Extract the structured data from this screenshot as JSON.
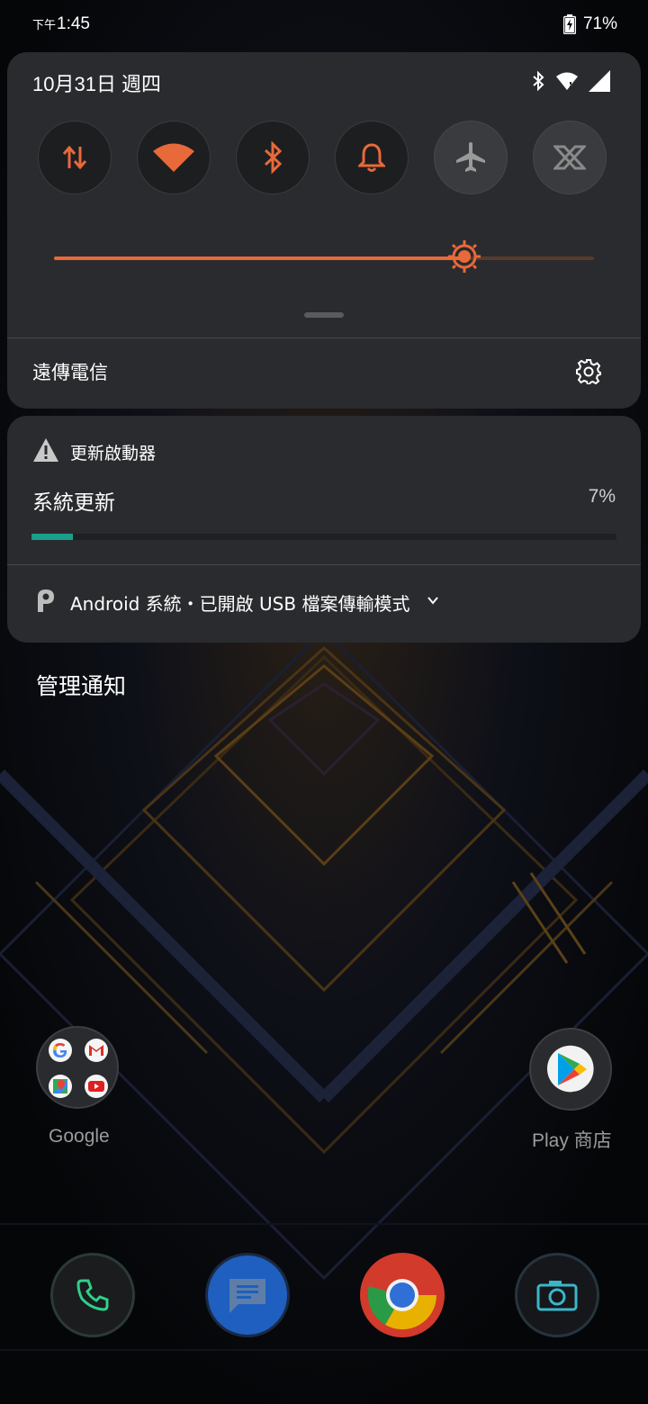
{
  "status_bar": {
    "time_prefix": "下午",
    "time": "1:45",
    "battery": "71%"
  },
  "quick_settings": {
    "date": "10月31日 週四",
    "status_icons": [
      "bluetooth-icon",
      "wifi-icon",
      "signal-icon"
    ],
    "tiles": [
      {
        "name": "mobile-data",
        "icon": "data-arrows-icon",
        "active": true
      },
      {
        "name": "wifi",
        "icon": "wifi-icon",
        "active": true
      },
      {
        "name": "bluetooth",
        "icon": "bluetooth-icon",
        "active": true
      },
      {
        "name": "sound",
        "icon": "bell-icon",
        "active": true
      },
      {
        "name": "airplane",
        "icon": "airplane-icon",
        "active": false
      },
      {
        "name": "x-mode",
        "icon": "x-mode-icon",
        "active": false
      }
    ],
    "brightness_fraction": 0.76,
    "carrier": "遠傳電信",
    "accent_color": "#e8693a"
  },
  "notifications": {
    "update": {
      "app_name": "更新啟動器",
      "title": "系統更新",
      "progress_text": "7%",
      "progress_fraction": 0.07,
      "progress_color": "#1a9e8c"
    },
    "usb": {
      "text": "Android 系統・已開啟 USB 檔案傳輸模式"
    }
  },
  "manage_notifications": "管理通知",
  "home": {
    "folder_label": "Google",
    "folder_apps": [
      "google-icon",
      "gmail-icon",
      "maps-icon",
      "youtube-icon"
    ],
    "playstore_label": "Play 商店",
    "dock": [
      "phone-icon",
      "messages-icon",
      "chrome-icon",
      "camera-icon"
    ]
  }
}
